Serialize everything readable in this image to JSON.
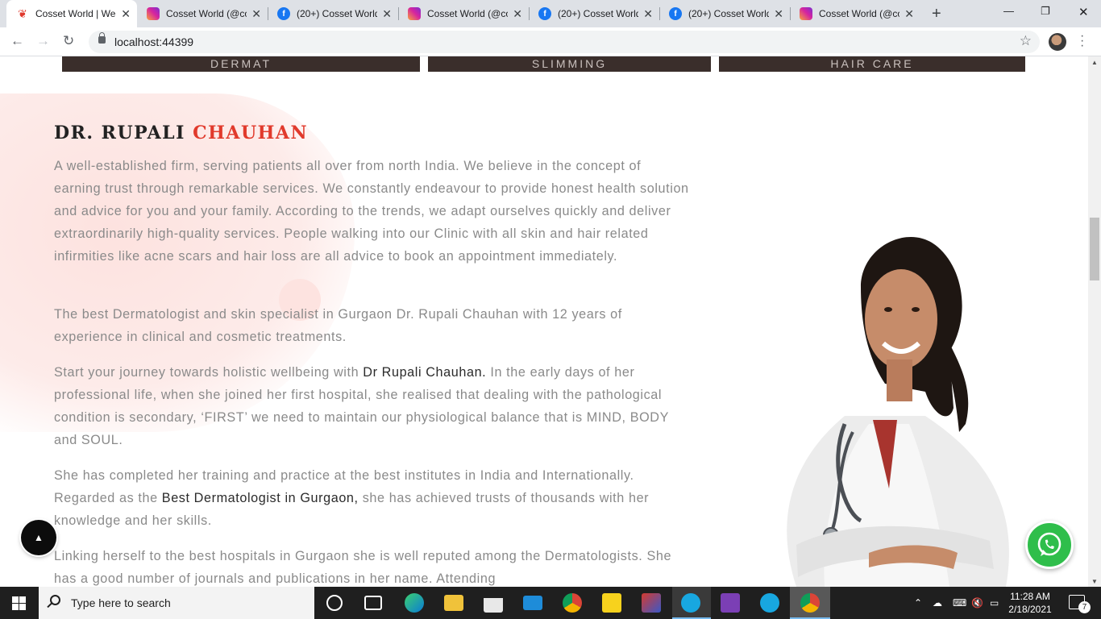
{
  "browser": {
    "tabs": [
      {
        "title": "Cosset World | We",
        "icon": "cosset-logo-icon",
        "active": true
      },
      {
        "title": "Cosset World (@co",
        "icon": "instagram-icon"
      },
      {
        "title": "(20+) Cosset World",
        "icon": "facebook-icon"
      },
      {
        "title": "Cosset World (@co",
        "icon": "instagram-icon"
      },
      {
        "title": "(20+) Cosset World",
        "icon": "facebook-icon"
      },
      {
        "title": "(20+) Cosset World",
        "icon": "facebook-icon"
      },
      {
        "title": "Cosset World (@co",
        "icon": "instagram-icon"
      }
    ],
    "url": "localhost:44399"
  },
  "service_cards": [
    {
      "label": "DERMAT"
    },
    {
      "label": "SLIMMING"
    },
    {
      "label": "HAIR CARE"
    }
  ],
  "about": {
    "heading_first": "DR. RUPALI",
    "heading_second": "CHAUHAN",
    "p1": "A well-established firm, serving patients all over from north India. We believe in the concept of earning trust through remarkable services. We constantly endeavour to provide honest health solution and advice for you and your family. According to the trends, we adapt ourselves quickly and deliver extraordinarily high-quality services. People walking into our Clinic with all skin and hair related infirmities like acne scars and hair loss are all advice to book an appointment immediately.",
    "p2": "The best Dermatologist and skin specialist in Gurgaon Dr. Rupali Chauhan with 12 years of experience in clinical and cosmetic treatments.",
    "p3_a": "Start your journey towards holistic wellbeing with ",
    "p3_b": "Dr Rupali Chauhan.",
    "p3_c": " In the early days of her professional life, when she joined her first hospital, she realised that dealing with the pathological condition is secondary, ‘FIRST’ we need to maintain our physiological balance that is MIND, BODY and SOUL.",
    "p4_a": "She has completed her training and practice at the best institutes in India and Internationally. Regarded as the ",
    "p4_b": "Best Dermatologist in Gurgaon,",
    "p4_c": " she has achieved trusts of thousands with her knowledge and her skills.",
    "p5": "Linking herself to the best hospitals in Gurgaon she is well reputed among the Dermatologists. She has a good number of journals and publications in her name. Attending"
  },
  "taskbar": {
    "search_placeholder": "Type here to search",
    "time": "11:28 AM",
    "date": "2/18/2021",
    "notification_count": "7"
  },
  "colors": {
    "accent_red": "#e13a2c",
    "whatsapp_green": "#2fbe4b",
    "blob_pink": "#fde2df"
  }
}
